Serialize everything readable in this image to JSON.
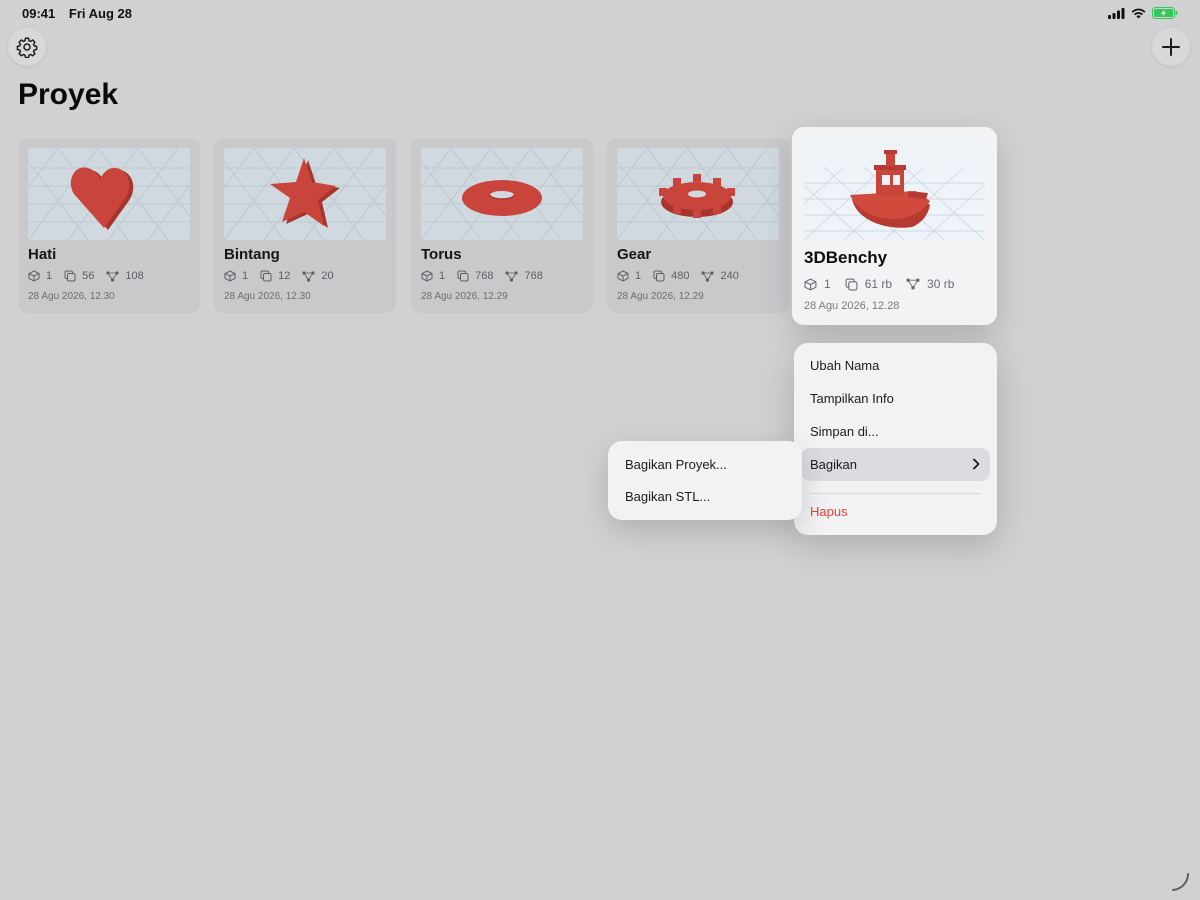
{
  "status_bar": {
    "time": "09:41",
    "date": "Fri Aug 28"
  },
  "title": "Proyek",
  "projects": [
    {
      "name": "Hati",
      "objects": "1",
      "triangles": "56",
      "vertices": "108",
      "date": "28 Agu 2026, 12.30",
      "shape": "heart"
    },
    {
      "name": "Bintang",
      "objects": "1",
      "triangles": "12",
      "vertices": "20",
      "date": "28 Agu 2026, 12.30",
      "shape": "star"
    },
    {
      "name": "Torus",
      "objects": "1",
      "triangles": "768",
      "vertices": "768",
      "date": "28 Agu 2026, 12.29",
      "shape": "torus"
    },
    {
      "name": "Gear",
      "objects": "1",
      "triangles": "480",
      "vertices": "240",
      "date": "28 Agu 2026, 12.29",
      "shape": "gear"
    },
    {
      "name": "3DBenchy",
      "objects": "1",
      "triangles": "61 rb",
      "vertices": "30 rb",
      "date": "28 Agu 2026, 12.28",
      "shape": "boat",
      "selected": true
    }
  ],
  "context_menu": {
    "items": [
      {
        "label": "Ubah Nama"
      },
      {
        "label": "Tampilkan Info"
      },
      {
        "label": "Simpan di..."
      },
      {
        "label": "Bagikan",
        "has_submenu": true,
        "highlighted": true
      }
    ],
    "destructive": {
      "label": "Hapus"
    }
  },
  "share_submenu": {
    "items": [
      {
        "label": "Bagikan Proyek..."
      },
      {
        "label": "Bagikan STL..."
      }
    ]
  },
  "colors": {
    "model": "#c9453b",
    "destructive": "#e2463c",
    "battery": "#34c759"
  }
}
